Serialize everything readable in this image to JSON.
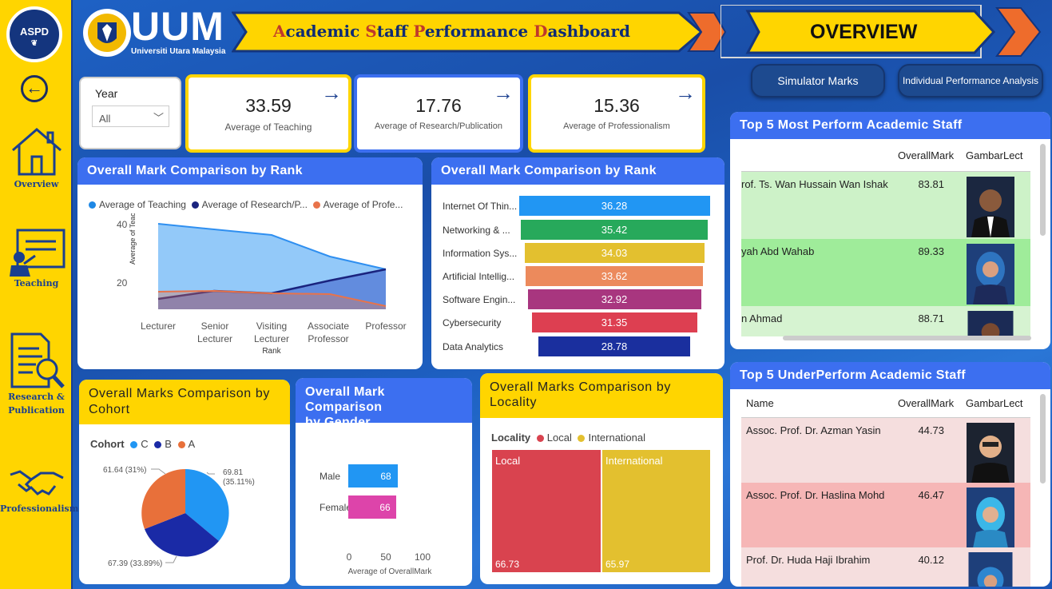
{
  "app": {
    "logo_text": "ASPD",
    "uum_text": "UUM",
    "uum_sub": "Universiti Utara Malaysia",
    "title_parts": [
      "A",
      "cademic ",
      "S",
      "taff ",
      "P",
      "erformance ",
      "D",
      "ashboard"
    ],
    "page_title": "OVERVIEW"
  },
  "sidebar": {
    "back_icon": "back-arrow-icon",
    "items": [
      {
        "label": "Overview",
        "icon": "home-icon"
      },
      {
        "label": "Teaching",
        "icon": "teaching-icon"
      },
      {
        "label_l1": "Research &",
        "label_l2": "Publication",
        "icon": "research-icon"
      },
      {
        "label": "Professionalism",
        "icon": "handshake-icon"
      }
    ]
  },
  "filter": {
    "label": "Year",
    "value": "All"
  },
  "kpis": [
    {
      "value": "33.59",
      "label": "Average of Teaching"
    },
    {
      "value": "17.76",
      "label": "Average of Research/Publication"
    },
    {
      "value": "15.36",
      "label": "Average of Professionalism"
    }
  ],
  "buttons": {
    "simulator": "Simulator Marks",
    "individual": "Individual Performance Analysis"
  },
  "colors": {
    "teaching": "#1e88e5",
    "research": "#1a237e",
    "professionalism": "#e8734a",
    "accent": "#ffd500",
    "header": "#3c6ff0"
  },
  "area_chart": {
    "title": "Overall Mark Comparison by Rank",
    "legend": [
      "Average of Teaching",
      "Average of Research/P...",
      "Average of Profe..."
    ],
    "ylabel": "Average of Teaching...",
    "xlabel": "Rank",
    "y_ticks": [
      "40",
      "20"
    ],
    "x_labels": [
      [
        "Lecturer"
      ],
      [
        "Senior",
        "Lecturer"
      ],
      [
        "Visiting",
        "Lecturer"
      ],
      [
        "Associate",
        "Professor"
      ],
      [
        "Professor"
      ]
    ]
  },
  "bar_chart": {
    "title": "Overall Mark Comparison by Rank",
    "rows": [
      {
        "label": "Internet Of Thin...",
        "value": "36.28",
        "color": "#2196f3"
      },
      {
        "label": "Networking & ...",
        "value": "35.42",
        "color": "#27a95b"
      },
      {
        "label": "Information Sys...",
        "value": "34.03",
        "color": "#e3c02f"
      },
      {
        "label": "Artificial Intellig...",
        "value": "33.62",
        "color": "#ec8a5c"
      },
      {
        "label": "Software Engin...",
        "value": "32.92",
        "color": "#a8367f"
      },
      {
        "label": "Cybersecurity",
        "value": "31.35",
        "color": "#dd3f51"
      },
      {
        "label": "Data Analytics",
        "value": "28.78",
        "color": "#1a2f9e"
      }
    ]
  },
  "pie_chart": {
    "title": "Overall Marks Comparison by Cohort",
    "legend_title": "Cohort",
    "legend": [
      {
        "name": "C",
        "color": "#2196f3"
      },
      {
        "name": "B",
        "color": "#1a2aa6"
      },
      {
        "name": "A",
        "color": "#e8703a"
      }
    ],
    "labels": {
      "c_l1": "69.81",
      "c_l2": "(35.11%)",
      "b": "67.39 (33.89%)",
      "a": "61.64 (31%)"
    }
  },
  "gender_chart": {
    "title_l1": "Overall Mark Comparison",
    "title_l2": "by Gender",
    "bars": [
      {
        "label": "Male",
        "value": "68",
        "color": "#2196f3"
      },
      {
        "label": "Female",
        "value": "66",
        "color": "#dd44aa"
      }
    ],
    "x_ticks": [
      "0",
      "50",
      "100"
    ],
    "xlabel": "Average of OverallMark"
  },
  "locality_chart": {
    "title_l1": "Overall Marks Comparison by",
    "title_l2": "Locality",
    "legend_title": "Locality",
    "legend": [
      {
        "name": "Local",
        "color": "#d9434f"
      },
      {
        "name": "International",
        "color": "#e3c02f"
      }
    ],
    "values": [
      "66.73",
      "65.97"
    ]
  },
  "top_table": {
    "title": "Top 5 Most Perform Academic Staff",
    "col_mark": "OverallMark",
    "col_photo": "GambarLect",
    "rows": [
      {
        "name": "rof. Ts. Wan Hussain Wan Ishak",
        "mark": "83.81"
      },
      {
        "name": "yah Abd Wahab",
        "mark": "89.33"
      },
      {
        "name": "n Ahmad",
        "mark": "88.71"
      }
    ]
  },
  "under_table": {
    "title": "Top 5 UnderPerform Academic Staff",
    "col_name": "Name",
    "col_mark": "OverallMark",
    "col_photo": "GambarLect",
    "rows": [
      {
        "name": "Assoc. Prof. Dr. Azman Yasin",
        "mark": "44.73"
      },
      {
        "name": "Assoc. Prof. Dr. Haslina Mohd",
        "mark": "46.47"
      },
      {
        "name": "Prof. Dr. Huda Haji Ibrahim",
        "mark": "40.12"
      }
    ]
  }
}
